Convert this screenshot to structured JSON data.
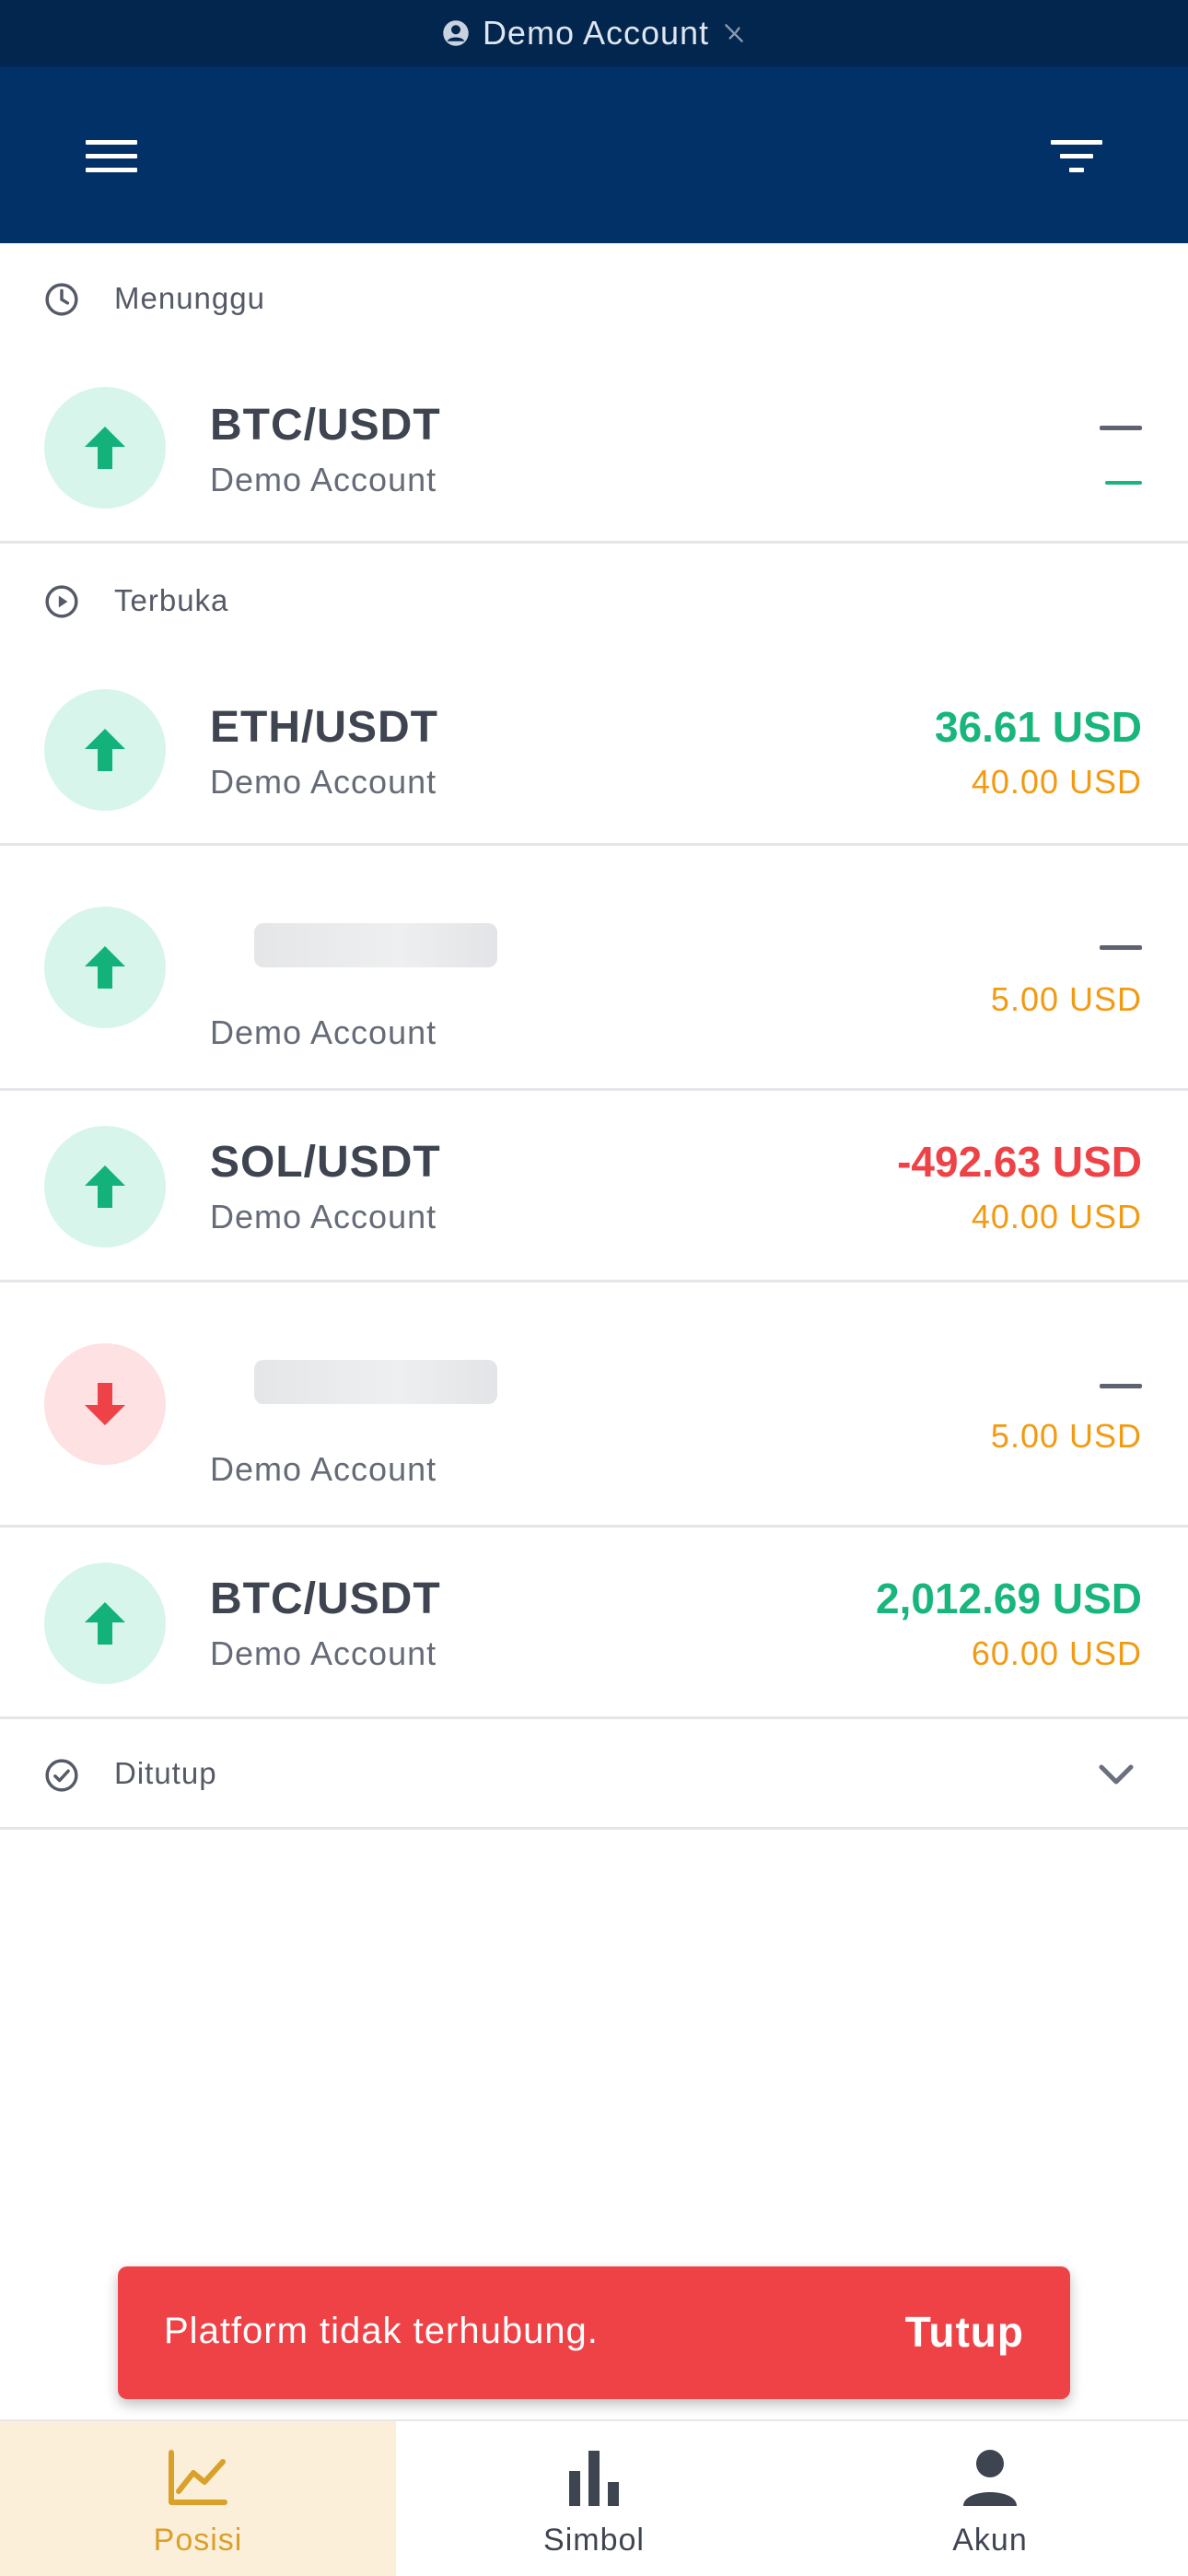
{
  "status_bar": {
    "account_label": "Demo Account"
  },
  "sections": {
    "pending": {
      "label": "Menunggu"
    },
    "open": {
      "label": "Terbuka"
    },
    "closed": {
      "label": "Ditutup"
    }
  },
  "pending_positions": [
    {
      "symbol": "BTC/USDT",
      "account": "Demo Account",
      "direction": "up"
    }
  ],
  "open_positions": [
    {
      "symbol": "ETH/USDT",
      "account": "Demo Account",
      "direction": "up",
      "pnl": "36.61 USD",
      "amount": "40.00 USD"
    },
    {
      "symbol": "",
      "account": "Demo Account",
      "direction": "up",
      "pnl": "",
      "amount": "5.00 USD"
    },
    {
      "symbol": "SOL/USDT",
      "account": "Demo Account",
      "direction": "up",
      "pnl": "-492.63 USD",
      "amount": "40.00 USD"
    },
    {
      "symbol": "",
      "account": "Demo Account",
      "direction": "down",
      "pnl": "",
      "amount": "5.00 USD"
    },
    {
      "symbol": "BTC/USDT",
      "account": "Demo Account",
      "direction": "up",
      "pnl": "2,012.69 USD",
      "amount": "60.00 USD"
    }
  ],
  "toast": {
    "message": "Platform tidak terhubung.",
    "action_label": "Tutup"
  },
  "bottom_nav": [
    {
      "label": "Posisi",
      "icon": "line-chart-icon",
      "active": true
    },
    {
      "label": "Simbol",
      "icon": "bar-chart-icon",
      "active": false
    },
    {
      "label": "Akun",
      "icon": "person-icon",
      "active": false
    }
  ],
  "colors": {
    "header_bg": "#013166",
    "status_bg": "#02264d",
    "profit": "#18b67c",
    "loss": "#ee4247",
    "amount": "#f29a12",
    "toast_bg": "#ef4247",
    "nav_active_bg": "#fbefd9",
    "nav_active_text": "#d9a02a"
  }
}
